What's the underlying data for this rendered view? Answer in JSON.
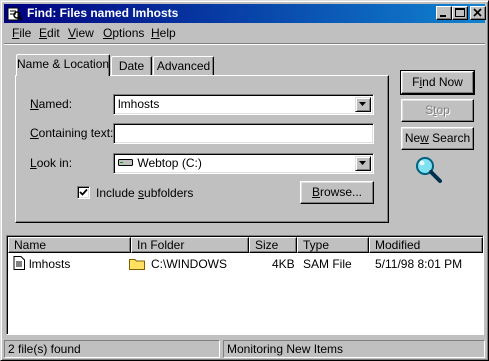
{
  "window": {
    "title": "Find: Files named lmhosts",
    "controls": [
      "minimize-icon",
      "maximize-icon",
      "close-icon"
    ]
  },
  "menu": {
    "file": {
      "accel": "F",
      "rest": "ile"
    },
    "edit": {
      "accel": "E",
      "rest": "dit"
    },
    "view": {
      "accel": "V",
      "rest": "iew"
    },
    "options": {
      "accel": "O",
      "rest": "ptions"
    },
    "help": {
      "accel": "H",
      "rest": "elp"
    }
  },
  "tabs": {
    "name_location": "Name & Location",
    "date": "Date",
    "advanced": "Advanced"
  },
  "form": {
    "named": {
      "accel": "N",
      "rest": "amed:",
      "value": "lmhosts"
    },
    "containing": {
      "accel": "C",
      "rest": "ontaining text:",
      "value": ""
    },
    "look_in": {
      "accel": "L",
      "rest": "ook in:",
      "value": "Webtop (C:)",
      "icon": "drive-icon"
    },
    "include_subfolders": {
      "pre": "Include ",
      "accel": "s",
      "rest": "ubfolders",
      "checked": true
    },
    "browse": {
      "accel": "B",
      "rest": "rowse..."
    }
  },
  "buttons": {
    "find_now": {
      "pre": "F",
      "accel": "i",
      "rest": "nd Now"
    },
    "stop": {
      "pre": "S",
      "accel": "t",
      "rest": "op",
      "disabled": true
    },
    "new_search": {
      "pre": "Ne",
      "accel": "w",
      "rest": " Search"
    }
  },
  "results": {
    "columns": [
      "Name",
      "In Folder",
      "Size",
      "Type",
      "Modified"
    ],
    "rows": [
      {
        "name": "lmhosts",
        "folder": "C:\\WINDOWS",
        "size": "4KB",
        "type": "SAM File",
        "modified": "5/11/98 8:01 PM"
      }
    ]
  },
  "status": {
    "found": "2 file(s) found",
    "monitoring": "Monitoring New Items"
  },
  "colors": {
    "title_start": "#000080",
    "title_end": "#1084d0",
    "face": "#c0c0c0",
    "search_icon": "#00a0c0"
  }
}
